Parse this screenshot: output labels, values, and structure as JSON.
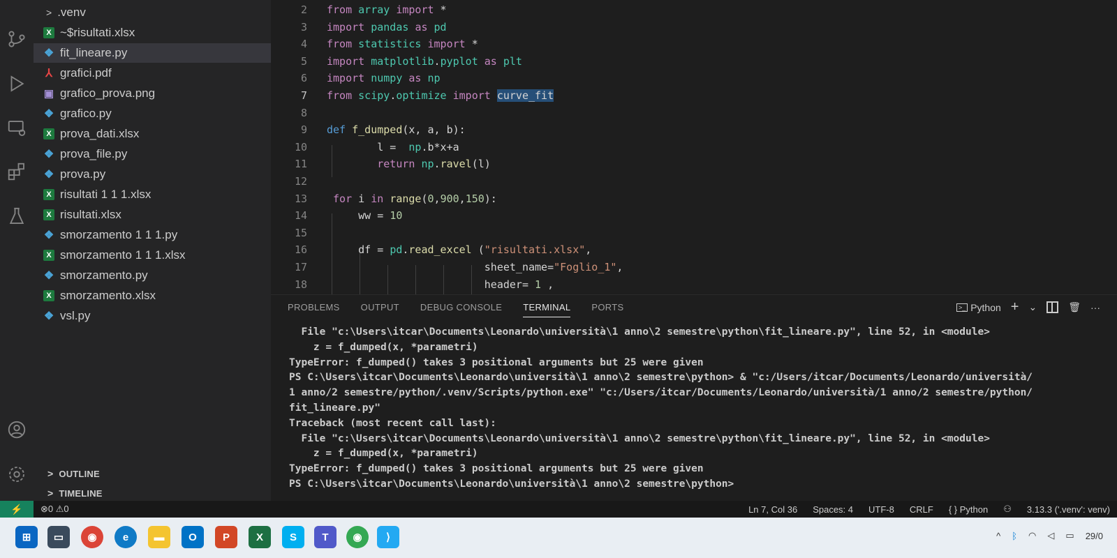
{
  "explorer": {
    "items": [
      {
        "label": ".venv",
        "type": "folder"
      },
      {
        "label": "~$risultati.xlsx",
        "type": "xlsx"
      },
      {
        "label": "fit_lineare.py",
        "type": "py",
        "selected": true
      },
      {
        "label": "grafici.pdf",
        "type": "pdf"
      },
      {
        "label": "grafico_prova.png",
        "type": "png"
      },
      {
        "label": "grafico.py",
        "type": "py"
      },
      {
        "label": "prova_dati.xlsx",
        "type": "xlsx"
      },
      {
        "label": "prova_file.py",
        "type": "py"
      },
      {
        "label": "prova.py",
        "type": "py"
      },
      {
        "label": "risultati 1 1 1.xlsx",
        "type": "xlsx"
      },
      {
        "label": "risultati.xlsx",
        "type": "xlsx"
      },
      {
        "label": "smorzamento 1 1 1.py",
        "type": "py"
      },
      {
        "label": "smorzamento 1 1 1.xlsx",
        "type": "xlsx"
      },
      {
        "label": "smorzamento.py",
        "type": "py"
      },
      {
        "label": "smorzamento.xlsx",
        "type": "xlsx"
      },
      {
        "label": "vsl.py",
        "type": "py"
      }
    ],
    "outline_label": "OUTLINE",
    "timeline_label": "TIMELINE"
  },
  "editor": {
    "lines": [
      {
        "n": "2",
        "text": "from array import *"
      },
      {
        "n": "3",
        "text": "import pandas as pd"
      },
      {
        "n": "4",
        "text": "from statistics import *"
      },
      {
        "n": "5",
        "text": "import matplotlib.pyplot as plt"
      },
      {
        "n": "6",
        "text": "import numpy as np"
      },
      {
        "n": "7",
        "text": "from scipy.optimize import curve_fit",
        "active": true
      },
      {
        "n": "8",
        "text": ""
      },
      {
        "n": "9",
        "text": "def f_dumped(x, a, b):"
      },
      {
        "n": "10",
        "text": "        l =  np.b*x+a"
      },
      {
        "n": "11",
        "text": "        return np.ravel(l)"
      },
      {
        "n": "12",
        "text": ""
      },
      {
        "n": "13",
        "text": " for i in range(0,900,150):"
      },
      {
        "n": "14",
        "text": "     ww = 10"
      },
      {
        "n": "15",
        "text": ""
      },
      {
        "n": "16",
        "text": "     df = pd.read_excel (\"risultati.xlsx\","
      },
      {
        "n": "17",
        "text": "                         sheet_name=\"Foglio_1\","
      },
      {
        "n": "18",
        "text": "                         header= 1 ,"
      }
    ]
  },
  "panel": {
    "tabs": [
      "PROBLEMS",
      "OUTPUT",
      "DEBUG CONSOLE",
      "TERMINAL",
      "PORTS"
    ],
    "active_tab": "TERMINAL",
    "shell_label": "Python",
    "terminal_lines": [
      "  File \"c:\\Users\\itcar\\Documents\\Leonardo\\università\\1 anno\\2 semestre\\python\\fit_lineare.py\", line 52, in <module>",
      "    z = f_dumped(x, *parametri)",
      "TypeError: f_dumped() takes 3 positional arguments but 25 were given",
      "PS C:\\Users\\itcar\\Documents\\Leonardo\\università\\1 anno\\2 semestre\\python> & \"c:/Users/itcar/Documents/Leonardo/università/",
      "1 anno/2 semestre/python/.venv/Scripts/python.exe\" \"c:/Users/itcar/Documents/Leonardo/università/1 anno/2 semestre/python/",
      "fit_lineare.py\"",
      "Traceback (most recent call last):",
      "  File \"c:\\Users\\itcar\\Documents\\Leonardo\\università\\1 anno\\2 semestre\\python\\fit_lineare.py\", line 52, in <module>",
      "    z = f_dumped(x, *parametri)",
      "TypeError: f_dumped() takes 3 positional arguments but 25 were given",
      "PS C:\\Users\\itcar\\Documents\\Leonardo\\università\\1 anno\\2 semestre\\python>"
    ]
  },
  "statusbar": {
    "problems": "⊗0 ⚠0",
    "position": "Ln 7, Col 36",
    "spaces": "Spaces: 4",
    "encoding": "UTF-8",
    "eol": "CRLF",
    "language": "{ } Python",
    "interpreter": "3.13.3 ('.venv': venv)"
  },
  "taskbar": {
    "date": "29/0"
  },
  "colors": {
    "accent": "#0078d4",
    "remote": "#16825d",
    "keyword": "#c586c0",
    "function": "#dcdcaa",
    "string": "#ce9178"
  }
}
